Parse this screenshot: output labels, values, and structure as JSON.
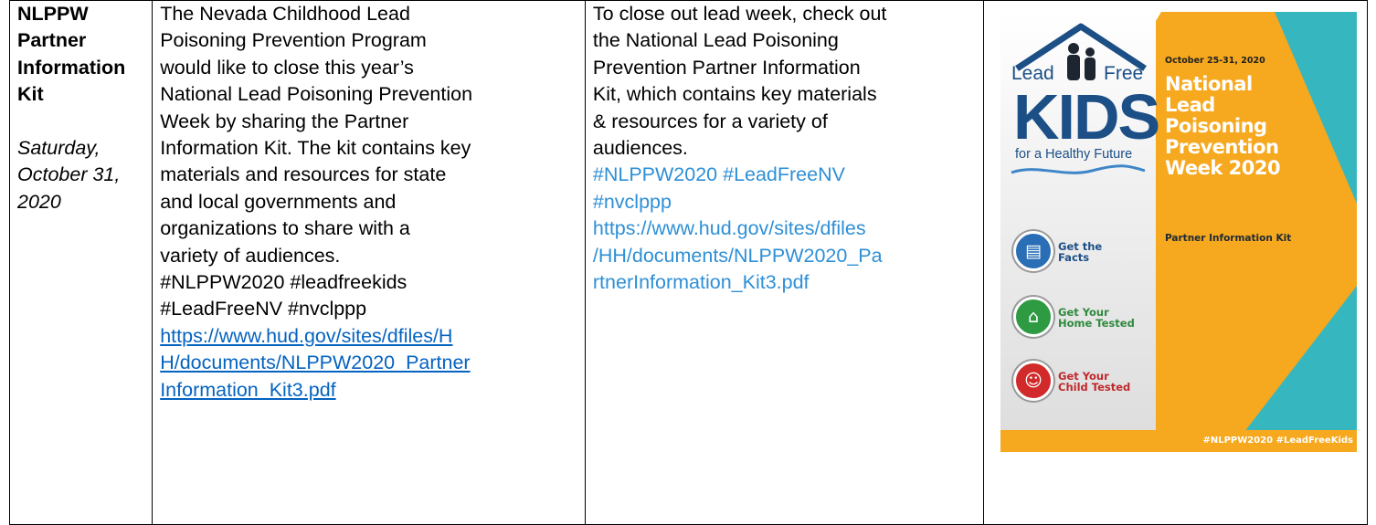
{
  "row": {
    "col1": {
      "title_lines": [
        "NLPPW",
        "Partner",
        "Information",
        "Kit"
      ],
      "date_lines": [
        "Saturday,",
        "October 31,",
        "2020"
      ]
    },
    "col2": {
      "text_lines": [
        "The Nevada Childhood Lead",
        "Poisoning Prevention Program",
        "would like to close this year’s",
        "National Lead Poisoning Prevention",
        "Week by sharing the Partner",
        "Information Kit. The kit contains key",
        "materials and resources for state",
        "and local governments and",
        "organizations to share with a",
        "variety of audiences."
      ],
      "tag_lines": [
        "#NLPPW2020 #leadfreekids",
        "#LeadFreeNV #nvclppp"
      ],
      "link_lines": [
        "https://www.hud.gov/sites/dfiles/H",
        "H/documents/NLPPW2020_Partner",
        "Information_Kit3.pdf"
      ]
    },
    "col3": {
      "text_lines": [
        "To close out lead week, check out",
        "the National Lead Poisoning",
        "Prevention Partner Information",
        "Kit, which contains key materials",
        "& resources for a variety of",
        "audiences."
      ],
      "tag_lines": [
        "#NLPPW2020 #LeadFreeNV",
        "#nvclppp"
      ],
      "link_lines": [
        "https://www.hud.gov/sites/dfiles",
        "/HH/documents/NLPPW2020_Pa",
        "rtnerInformation_Kit3.pdf"
      ]
    },
    "poster": {
      "logo_lead": "Lead",
      "logo_free": "Free",
      "logo_kids": "KIDS",
      "logo_tagline": "for a Healthy Future",
      "actions": [
        {
          "icon": "document-icon",
          "color": "#2a6fb6",
          "line1": "Get the",
          "line2": "Facts",
          "text_color": "#1c4f86"
        },
        {
          "icon": "house-icon",
          "color": "#2e9b43",
          "line1": "Get Your",
          "line2": "Home Tested",
          "text_color": "#2e8a3e"
        },
        {
          "icon": "child-icon",
          "color": "#d22a2a",
          "line1": "Get Your",
          "line2": "Child Tested",
          "text_color": "#c0282b"
        }
      ],
      "date": "October 25-31, 2020",
      "title_lines": [
        "National",
        "Lead",
        "Poisoning",
        "Prevention",
        "Week 2020"
      ],
      "subtitle": "Partner Information Kit",
      "hashtags": "#NLPPW2020 #LeadFreeKids",
      "colors": {
        "orange": "#f6a81e",
        "teal": "#36b7bf",
        "navy": "#1c4f86"
      }
    }
  }
}
